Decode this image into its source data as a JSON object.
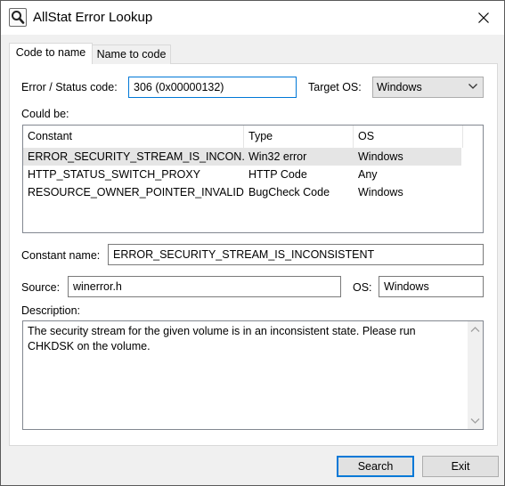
{
  "window": {
    "title": "AllStat Error Lookup"
  },
  "tabs": [
    {
      "label": "Code to name",
      "active": true
    },
    {
      "label": "Name to code",
      "active": false
    }
  ],
  "form": {
    "code_label": "Error / Status code:",
    "code_value": "306 (0x00000132)",
    "target_os_label": "Target OS:",
    "target_os_value": "Windows",
    "could_be_label": "Could be:"
  },
  "results": {
    "columns": [
      "Constant",
      "Type",
      "OS"
    ],
    "rows": [
      {
        "constant": "ERROR_SECURITY_STREAM_IS_INCON...",
        "type": "Win32 error",
        "os": "Windows",
        "selected": true
      },
      {
        "constant": "HTTP_STATUS_SWITCH_PROXY",
        "type": "HTTP Code",
        "os": "Any",
        "selected": false
      },
      {
        "constant": "RESOURCE_OWNER_POINTER_INVALID",
        "type": "BugCheck Code",
        "os": "Windows",
        "selected": false
      }
    ]
  },
  "details": {
    "constant_name_label": "Constant name:",
    "constant_name_value": "ERROR_SECURITY_STREAM_IS_INCONSISTENT",
    "source_label": "Source:",
    "source_value": "winerror.h",
    "os_label": "OS:",
    "os_value": "Windows",
    "description_label": "Description:",
    "description_value": "The security stream for the given volume is in an inconsistent state. Please run CHKDSK on the volume."
  },
  "buttons": {
    "search": "Search",
    "exit": "Exit"
  },
  "icons": {
    "app": "magnifier-icon",
    "close": "close-icon",
    "dropdown": "chevron-down-icon",
    "scroll_up": "scroll-up-icon",
    "scroll_down": "scroll-down-icon"
  },
  "colors": {
    "focus_border": "#0078d7",
    "selected_row": "#e5e5e5",
    "window_bg": "#f0f0f0"
  }
}
